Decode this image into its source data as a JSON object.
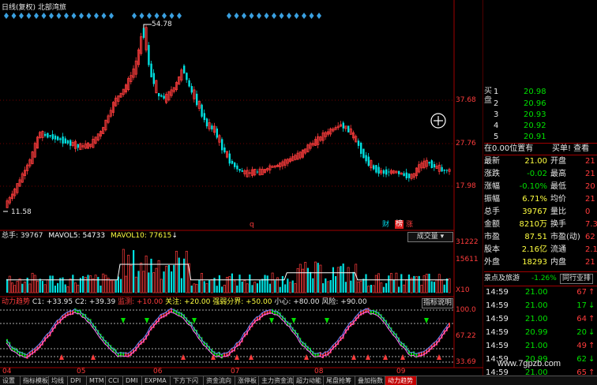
{
  "header": {
    "period": "日线(复权)",
    "stock_name": "北部湾旅"
  },
  "price_chart": {
    "high_label": "54.78",
    "low_label": "11.58",
    "axis_ticks": [
      "37.68",
      "27.76",
      "17.98"
    ],
    "markers": [
      "q",
      "财",
      "榜",
      "涨"
    ]
  },
  "volume_panel": {
    "label_total": "总手: 39767",
    "label_mavol5": "MAVOL5: 54733",
    "label_mavol10": "MAVOL10: 77615",
    "selector": "成交量",
    "axis_ticks": [
      "31222",
      "15611",
      "X10"
    ]
  },
  "indicator_panel": {
    "name": "动力趋势",
    "c1": "C1: +33.95",
    "c2": "C2: +39.39",
    "danger": "监测: +10.00",
    "watch": "关注: +20.00",
    "strong_weak": "强弱分界: +50.00",
    "careful": "小心: +80.00",
    "risk": "风险: +90.00",
    "help_button": "指标说明",
    "axis_ticks": [
      "100.0",
      "67.22",
      "33.69"
    ]
  },
  "x_axis": {
    "months": [
      "04",
      "05",
      "06",
      "07",
      "08",
      "09"
    ]
  },
  "quote_panel": {
    "sell_label": "卖盘",
    "buy_label": "买盘",
    "sell_rows": [
      {
        "level": "5",
        "price": "21.00"
      },
      {
        "level": "4",
        "price": "20.99"
      }
    ],
    "buy_rows": [
      {
        "level": "1",
        "price": "20.98"
      },
      {
        "level": "2",
        "price": "20.96"
      },
      {
        "level": "3",
        "price": "20.93"
      },
      {
        "level": "4",
        "price": "20.92"
      },
      {
        "level": "5",
        "price": "20.91"
      }
    ],
    "position_status": "在0.00位置有",
    "buy1_link": "买单! 查看",
    "stats": [
      {
        "k1": "最新",
        "v1": "21.00",
        "k2": "开盘",
        "v2": "21"
      },
      {
        "k1": "涨跌",
        "v1": "-0.02",
        "k2": "最高",
        "v2": "21"
      },
      {
        "k1": "涨幅",
        "v1": "-0.10%",
        "k2": "最低",
        "v2": "20"
      },
      {
        "k1": "振幅",
        "v1": "6.71%",
        "k2": "均价",
        "v2": "21"
      },
      {
        "k1": "总手",
        "v1": "39767",
        "k2": "量比",
        "v2": "0"
      },
      {
        "k1": "金额",
        "v1": "8210万",
        "k2": "换手",
        "v2": "7.3"
      },
      {
        "k1": "市盈",
        "v1": "87.51",
        "k2": "市盈(动)",
        "v2": "62"
      },
      {
        "k1": "股本",
        "v1": "2.16亿",
        "k2": "流通",
        "v2": "2.1"
      },
      {
        "k1": "外盘",
        "v1": "18293",
        "k2": "内盘",
        "v2": "21"
      }
    ],
    "sector_name": "景点及旅游",
    "sector_change": "-1.26%",
    "sector_tab": "同行业排",
    "trades": [
      {
        "time": "14:59",
        "price": "21.00",
        "vol": "67"
      },
      {
        "time": "14:59",
        "price": "21.00",
        "vol": "17"
      },
      {
        "time": "14:59",
        "price": "21.00",
        "vol": "64"
      },
      {
        "time": "14:59",
        "price": "20.99",
        "vol": "20"
      },
      {
        "time": "14:59",
        "price": "21.00",
        "vol": "49"
      },
      {
        "time": "14:59",
        "price": "20.99",
        "vol": "62"
      },
      {
        "time": "14:59",
        "price": "21.00",
        "vol": "65"
      }
    ],
    "watermark": "www.7gpzb.com"
  },
  "bottom_tabs": [
    "设置",
    "指标模板",
    "均线",
    "DPI",
    "MTM",
    "CCI",
    "DMI",
    "EXPMA",
    "下方下闪",
    "资金流向",
    "涨停板",
    "主力资金流",
    "超力动能",
    "尾盘抢筹",
    "叠加指数",
    "动力趋势"
  ],
  "colors": {
    "up": "#ff3c3c",
    "down": "#00e0e0",
    "accent": "#c00000"
  }
}
